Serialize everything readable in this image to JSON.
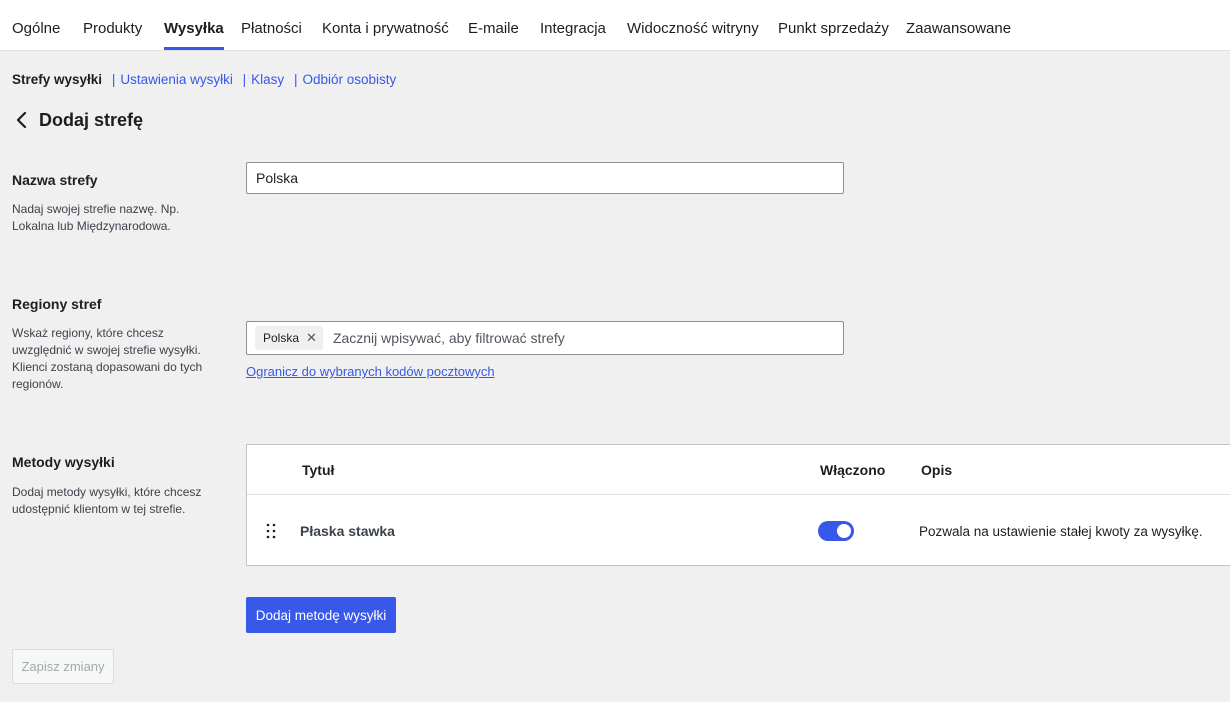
{
  "tabs": [
    {
      "label": "Ogólne",
      "active": false
    },
    {
      "label": "Produkty",
      "active": false
    },
    {
      "label": "Wysyłka",
      "active": true
    },
    {
      "label": "Płatności",
      "active": false
    },
    {
      "label": "Konta i prywatność",
      "active": false
    },
    {
      "label": "E-maile",
      "active": false
    },
    {
      "label": "Integracja",
      "active": false
    },
    {
      "label": "Widoczność witryny",
      "active": false
    },
    {
      "label": "Punkt sprzedaży",
      "active": false
    },
    {
      "label": "Zaawansowane",
      "active": false
    }
  ],
  "subnav": {
    "current": "Strefy wysyłki",
    "separator": "|",
    "links": [
      "Ustawienia wysyłki",
      "Klasy",
      "Odbiór osobisty"
    ]
  },
  "page": {
    "title": "Dodaj strefę",
    "back_icon": "chevron-left-icon"
  },
  "zone_name": {
    "title": "Nazwa strefy",
    "description": "Nadaj swojej strefie nazwę. Np. Lokalna lub Międzynarodowa.",
    "value": "Polska"
  },
  "zone_regions": {
    "title": "Regiony stref",
    "description": "Wskaż regiony, które chcesz uwzględnić w swojej strefie wysyłki. Klienci zostaną dopasowani do tych regionów.",
    "tag": "Polska",
    "remove_icon": "close-icon",
    "placeholder": "Zacznij wpisywać, aby filtrować strefy",
    "postcode_link": "Ogranicz do wybranych kodów pocztowych"
  },
  "shipping_methods": {
    "title": "Metody wysyłki",
    "description": "Dodaj metody wysyłki, które chcesz udostępnić klientom w tej strefie.",
    "columns": {
      "title": "Tytuł",
      "enabled": "Włączono",
      "description": "Opis"
    },
    "rows": [
      {
        "title": "Płaska stawka",
        "enabled": true,
        "description": "Pozwala na ustawienie stałej kwoty za wysyłkę."
      }
    ],
    "add_button": "Dodaj metodę wysyłki"
  },
  "save_button": "Zapisz zmiany",
  "colors": {
    "accent": "#3858e9",
    "background": "#f0f0f1",
    "panel": "#ffffff"
  }
}
